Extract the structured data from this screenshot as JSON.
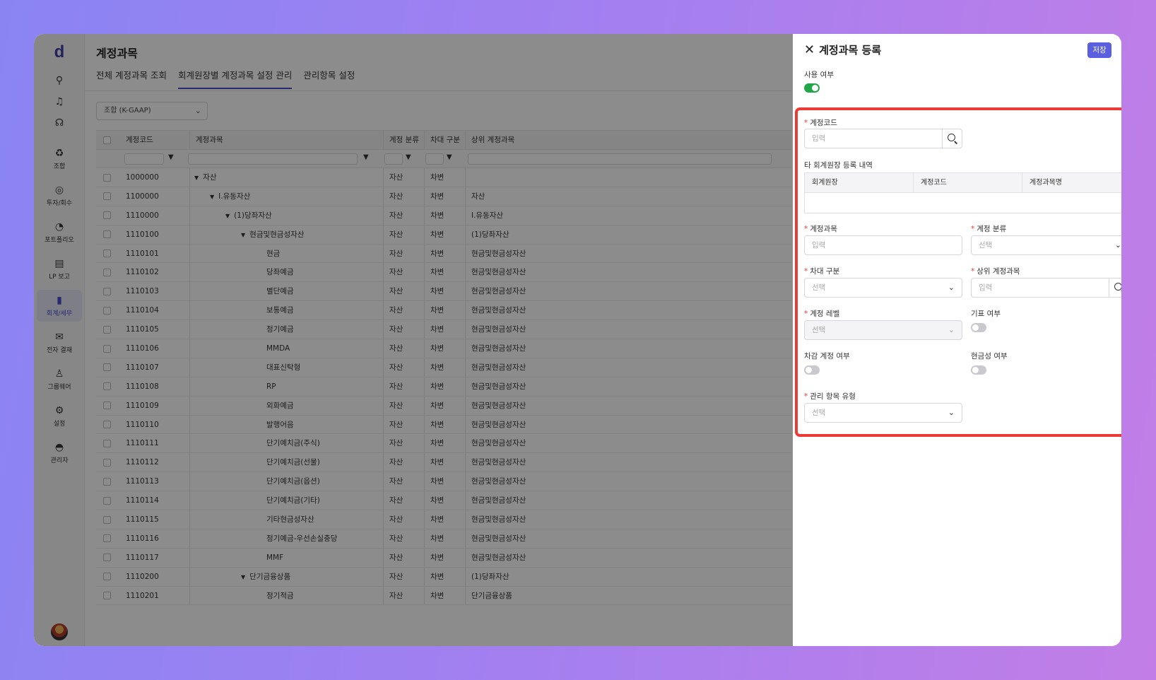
{
  "app": {
    "logo": "d"
  },
  "rail": {
    "items": [
      {
        "label": "조합",
        "icon": "recycle-icon"
      },
      {
        "label": "투자/회수",
        "icon": "coins-icon"
      },
      {
        "label": "포트폴리오",
        "icon": "pie-chart-icon"
      },
      {
        "label": "LP 보고",
        "icon": "document-icon"
      },
      {
        "label": "회계/세무",
        "icon": "ledger-icon"
      },
      {
        "label": "전자 결재",
        "icon": "mail-icon"
      },
      {
        "label": "그룹웨어",
        "icon": "people-icon"
      },
      {
        "label": "설정",
        "icon": "gear-icon"
      },
      {
        "label": "관리자",
        "icon": "admin-icon"
      }
    ]
  },
  "main": {
    "title": "계정과목",
    "tabs": [
      "전체 계정과목 조회",
      "회계원장별 계정과목 설정 관리",
      "관리항목 설정"
    ],
    "gaap_select": "조합 (K-GAAP)",
    "columns": [
      "계정코드",
      "계정과목",
      "계정 분류",
      "차대 구분",
      "상위 계정과목"
    ],
    "rows": [
      {
        "code": "1000000",
        "name": "자산",
        "level": 0,
        "tree": true,
        "cls": "자산",
        "dc": "차변",
        "parent": ""
      },
      {
        "code": "1100000",
        "name": "I.유동자산",
        "level": 1,
        "tree": true,
        "cls": "자산",
        "dc": "차변",
        "parent": "자산"
      },
      {
        "code": "1110000",
        "name": "(1)당좌자산",
        "level": 2,
        "tree": true,
        "cls": "자산",
        "dc": "차변",
        "parent": "I.유동자산"
      },
      {
        "code": "1110100",
        "name": "현금및현금성자산",
        "level": 3,
        "tree": true,
        "cls": "자산",
        "dc": "차변",
        "parent": "(1)당좌자산"
      },
      {
        "code": "1110101",
        "name": "현금",
        "level": 4,
        "tree": false,
        "cls": "자산",
        "dc": "차변",
        "parent": "현금및현금성자산"
      },
      {
        "code": "1110102",
        "name": "당좌예금",
        "level": 4,
        "tree": false,
        "cls": "자산",
        "dc": "차변",
        "parent": "현금및현금성자산"
      },
      {
        "code": "1110103",
        "name": "별단예금",
        "level": 4,
        "tree": false,
        "cls": "자산",
        "dc": "차변",
        "parent": "현금및현금성자산"
      },
      {
        "code": "1110104",
        "name": "보통예금",
        "level": 4,
        "tree": false,
        "cls": "자산",
        "dc": "차변",
        "parent": "현금및현금성자산"
      },
      {
        "code": "1110105",
        "name": "정기예금",
        "level": 4,
        "tree": false,
        "cls": "자산",
        "dc": "차변",
        "parent": "현금및현금성자산"
      },
      {
        "code": "1110106",
        "name": "MMDA",
        "level": 4,
        "tree": false,
        "cls": "자산",
        "dc": "차변",
        "parent": "현금및현금성자산"
      },
      {
        "code": "1110107",
        "name": "대표신탁형",
        "level": 4,
        "tree": false,
        "cls": "자산",
        "dc": "차변",
        "parent": "현금및현금성자산"
      },
      {
        "code": "1110108",
        "name": "RP",
        "level": 4,
        "tree": false,
        "cls": "자산",
        "dc": "차변",
        "parent": "현금및현금성자산"
      },
      {
        "code": "1110109",
        "name": "외화예금",
        "level": 4,
        "tree": false,
        "cls": "자산",
        "dc": "차변",
        "parent": "현금및현금성자산"
      },
      {
        "code": "1110110",
        "name": "발행어음",
        "level": 4,
        "tree": false,
        "cls": "자산",
        "dc": "차변",
        "parent": "현금및현금성자산"
      },
      {
        "code": "1110111",
        "name": "단기예치금(주식)",
        "level": 4,
        "tree": false,
        "cls": "자산",
        "dc": "차변",
        "parent": "현금및현금성자산"
      },
      {
        "code": "1110112",
        "name": "단기예치금(선물)",
        "level": 4,
        "tree": false,
        "cls": "자산",
        "dc": "차변",
        "parent": "현금및현금성자산"
      },
      {
        "code": "1110113",
        "name": "단기예치금(옵션)",
        "level": 4,
        "tree": false,
        "cls": "자산",
        "dc": "차변",
        "parent": "현금및현금성자산"
      },
      {
        "code": "1110114",
        "name": "단기예치금(기타)",
        "level": 4,
        "tree": false,
        "cls": "자산",
        "dc": "차변",
        "parent": "현금및현금성자산"
      },
      {
        "code": "1110115",
        "name": "기타현금성자산",
        "level": 4,
        "tree": false,
        "cls": "자산",
        "dc": "차변",
        "parent": "현금및현금성자산"
      },
      {
        "code": "1110116",
        "name": "정기예금-우선손실충당",
        "level": 4,
        "tree": false,
        "cls": "자산",
        "dc": "차변",
        "parent": "현금및현금성자산"
      },
      {
        "code": "1110117",
        "name": "MMF",
        "level": 4,
        "tree": false,
        "cls": "자산",
        "dc": "차변",
        "parent": "현금및현금성자산"
      },
      {
        "code": "1110200",
        "name": "단기금융상품",
        "level": 3,
        "tree": true,
        "cls": "자산",
        "dc": "차변",
        "parent": "(1)당좌자산"
      },
      {
        "code": "1110201",
        "name": "정기적금",
        "level": 4,
        "tree": false,
        "cls": "자산",
        "dc": "차변",
        "parent": "단기금융상품"
      }
    ]
  },
  "panel": {
    "title": "계정과목 등록",
    "save_label": "저장",
    "use_label": "사용 여부",
    "use_on": true,
    "account_code_label": "계정코드",
    "account_code_placeholder": "입력",
    "other_ledger_label": "타 회계원장 등록 내역",
    "other_ledger_columns": [
      "회계원장",
      "계정코드",
      "계정과목명"
    ],
    "account_name_label": "계정과목",
    "account_name_placeholder": "입력",
    "account_class_label": "계정 분류",
    "account_class_placeholder": "선택",
    "dc_label": "차대 구분",
    "dc_placeholder": "선택",
    "parent_label": "상위 계정과목",
    "parent_placeholder": "입력",
    "level_label": "계정 레벨",
    "level_placeholder": "선택",
    "voucher_label": "기표 여부",
    "voucher_on": false,
    "contra_label": "차감 계정 여부",
    "contra_on": false,
    "cash_label": "현금성 여부",
    "cash_on": false,
    "mgmt_type_label": "관리 항목 유형",
    "mgmt_type_placeholder": "선택"
  },
  "colors": {
    "accent": "#5a5fe0",
    "highlight": "#ec3b36",
    "toggle_on": "#22a64a"
  }
}
